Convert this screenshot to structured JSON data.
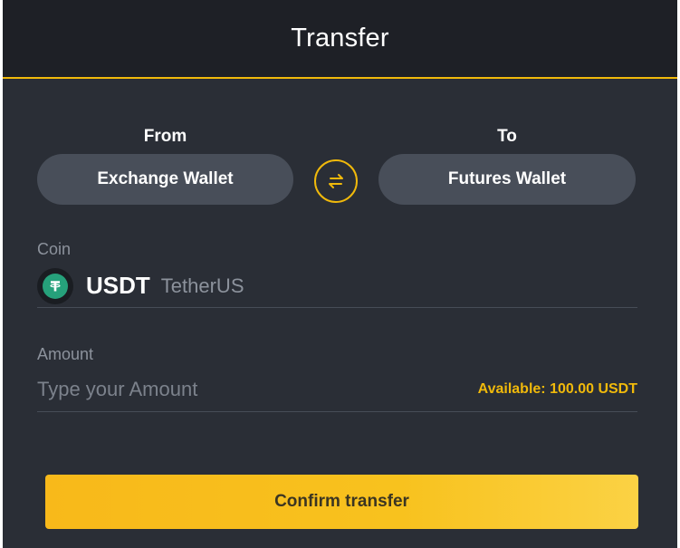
{
  "header": {
    "title": "Transfer"
  },
  "transfer": {
    "from_label": "From",
    "to_label": "To",
    "from_wallet": "Exchange Wallet",
    "to_wallet": "Futures Wallet",
    "swap_icon": "swap-arrows-icon"
  },
  "coin": {
    "label": "Coin",
    "symbol": "USDT",
    "name": "TetherUS",
    "icon": "tether-icon",
    "icon_color": "#26a17b"
  },
  "amount": {
    "label": "Amount",
    "placeholder": "Type your Amount",
    "value": "",
    "available": "Available: 100.00 USDT"
  },
  "actions": {
    "confirm_label": "Confirm transfer"
  },
  "colors": {
    "accent": "#f0b90b",
    "panel_bg": "#2a2e36",
    "header_bg": "#1e2026",
    "button_bg": "#484e59"
  }
}
